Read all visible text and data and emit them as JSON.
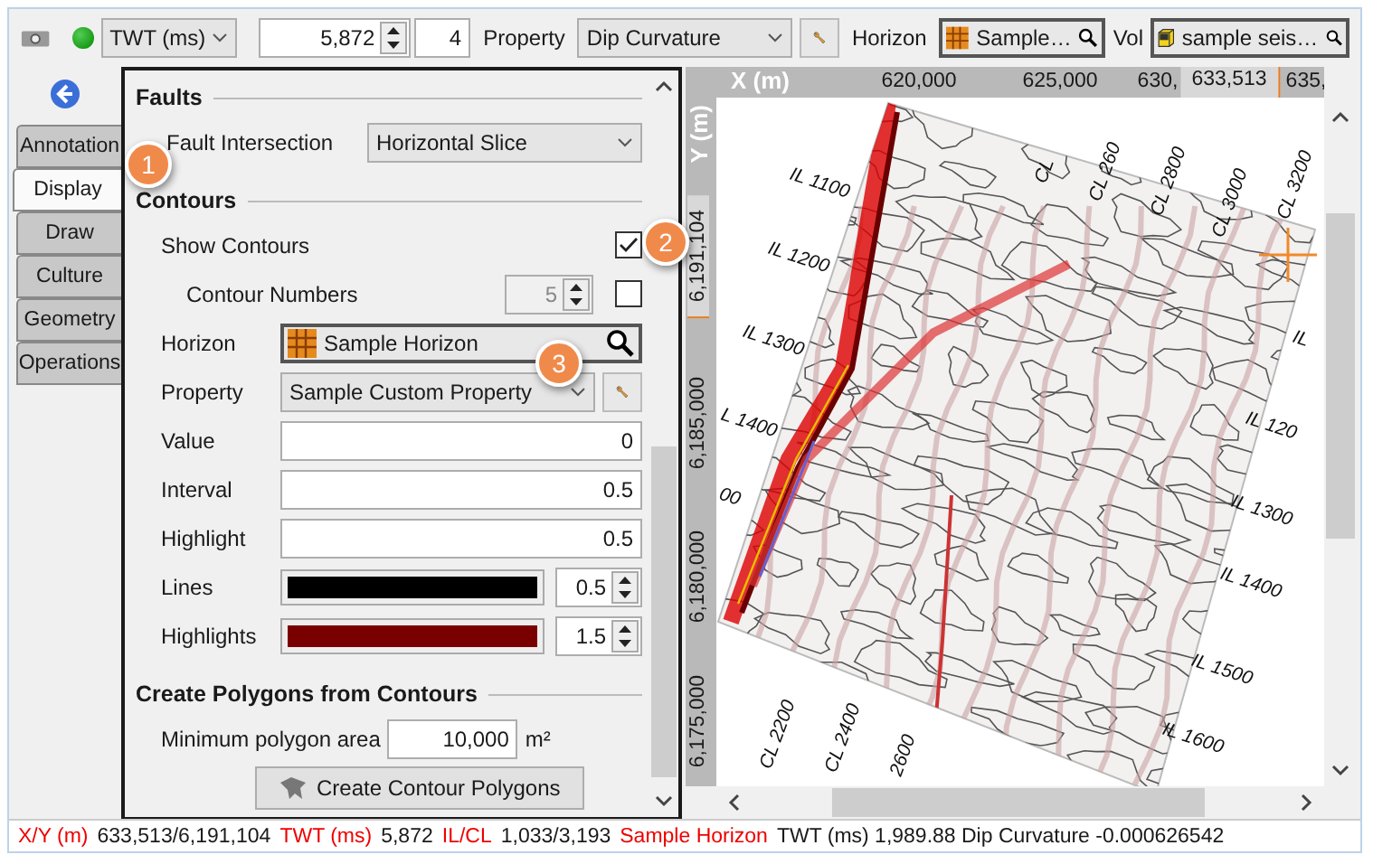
{
  "toolbar": {
    "domain_dropdown": "TWT (ms)",
    "time_value": "5,872",
    "step_value": "4",
    "property_label": "Property",
    "property_dropdown": "Dip Curvature",
    "horizon_label": "Horizon",
    "horizon_picker": "Sample…",
    "volume_label": "Vol",
    "volume_picker": "sample seis…"
  },
  "side_tabs": [
    {
      "label": "Annotation",
      "selected": false
    },
    {
      "label": "Display",
      "selected": true
    },
    {
      "label": "Draw",
      "selected": false
    },
    {
      "label": "Culture",
      "selected": false
    },
    {
      "label": "Geometry",
      "selected": false
    },
    {
      "label": "Operations",
      "selected": false
    }
  ],
  "sections": [
    {
      "title": "Faults",
      "rows": [
        {
          "kind": "dropdown",
          "label": "Fault Intersection",
          "value": "Horizontal Slice"
        }
      ]
    },
    {
      "title": "Contours",
      "rows": [
        {
          "kind": "checkbox",
          "label": "Show Contours",
          "checked": true
        },
        {
          "kind": "checkbox_spinner",
          "label": "Contour Numbers",
          "value": "5",
          "disabled": true,
          "checked": false
        },
        {
          "kind": "picker",
          "label": "Horizon",
          "value": "Sample Horizon"
        },
        {
          "kind": "dropdown_button",
          "label": "Property",
          "value": "Sample Custom Property"
        },
        {
          "kind": "number",
          "label": "Value",
          "value": "0"
        },
        {
          "kind": "number",
          "label": "Interval",
          "value": "0.5"
        },
        {
          "kind": "number",
          "label": "Highlight",
          "value": "0.5"
        },
        {
          "kind": "color_spinner",
          "label": "Lines",
          "color": "#000000",
          "value": "0.5"
        },
        {
          "kind": "color_spinner",
          "label": "Highlights",
          "color": "#7a0000",
          "value": "1.5"
        }
      ]
    },
    {
      "title": "Create Polygons from Contours",
      "rows": [
        {
          "kind": "area",
          "label": "Minimum polygon area",
          "value": "10,000",
          "unit": "m²"
        },
        {
          "kind": "button",
          "label": "Create Contour Polygons"
        }
      ]
    }
  ],
  "map": {
    "x_axis_label": "X (m)",
    "y_axis_label": "Y (m)",
    "x_ticks": [
      {
        "label": "620,000",
        "highlighted": false
      },
      {
        "label": "625,000",
        "highlighted": false
      },
      {
        "label": "630,",
        "highlighted": false
      },
      {
        "label": "633,513",
        "highlighted": true
      },
      {
        "label": "635,",
        "highlighted": false
      }
    ],
    "y_ticks": [
      {
        "label": "6,191,104",
        "highlighted": true
      },
      {
        "label": "6,185,000",
        "highlighted": false
      },
      {
        "label": "6,180,000",
        "highlighted": false
      },
      {
        "label": "6,175,000",
        "highlighted": false
      }
    ],
    "grid_labels": [
      {
        "text": "IL 1100",
        "kind": "inline"
      },
      {
        "text": "IL 1200",
        "kind": "inline"
      },
      {
        "text": "IL 1300",
        "kind": "inline"
      },
      {
        "text": "L 1400",
        "kind": "inline"
      },
      {
        "text": "00",
        "kind": "inline"
      },
      {
        "text": "CL",
        "kind": "crossline"
      },
      {
        "text": "CL 260",
        "kind": "crossline"
      },
      {
        "text": "CL 2800",
        "kind": "crossline"
      },
      {
        "text": "CL 3000",
        "kind": "crossline"
      },
      {
        "text": "CL 3200",
        "kind": "crossline"
      },
      {
        "text": "IL",
        "kind": "inline"
      },
      {
        "text": "IL 120",
        "kind": "inline"
      },
      {
        "text": "IL 1300",
        "kind": "inline"
      },
      {
        "text": "IL 1400",
        "kind": "inline"
      },
      {
        "text": "IL 1500",
        "kind": "inline"
      },
      {
        "text": "IL 1600",
        "kind": "inline"
      },
      {
        "text": "CL 2200",
        "kind": "crossline"
      },
      {
        "text": "CL 2400",
        "kind": "crossline"
      },
      {
        "text": "2600",
        "kind": "crossline"
      }
    ]
  },
  "callouts": [
    "1",
    "2",
    "3"
  ],
  "status_bar": [
    {
      "label": "X/Y (m)",
      "value": "633,513/6,191,104"
    },
    {
      "label": "TWT (ms)",
      "value": "5,872"
    },
    {
      "label": "IL/CL",
      "value": "1,033/3,193"
    },
    {
      "label": "Sample Horizon",
      "value": "TWT (ms) 1,989.88 Dip Curvature -0.000626542"
    }
  ]
}
